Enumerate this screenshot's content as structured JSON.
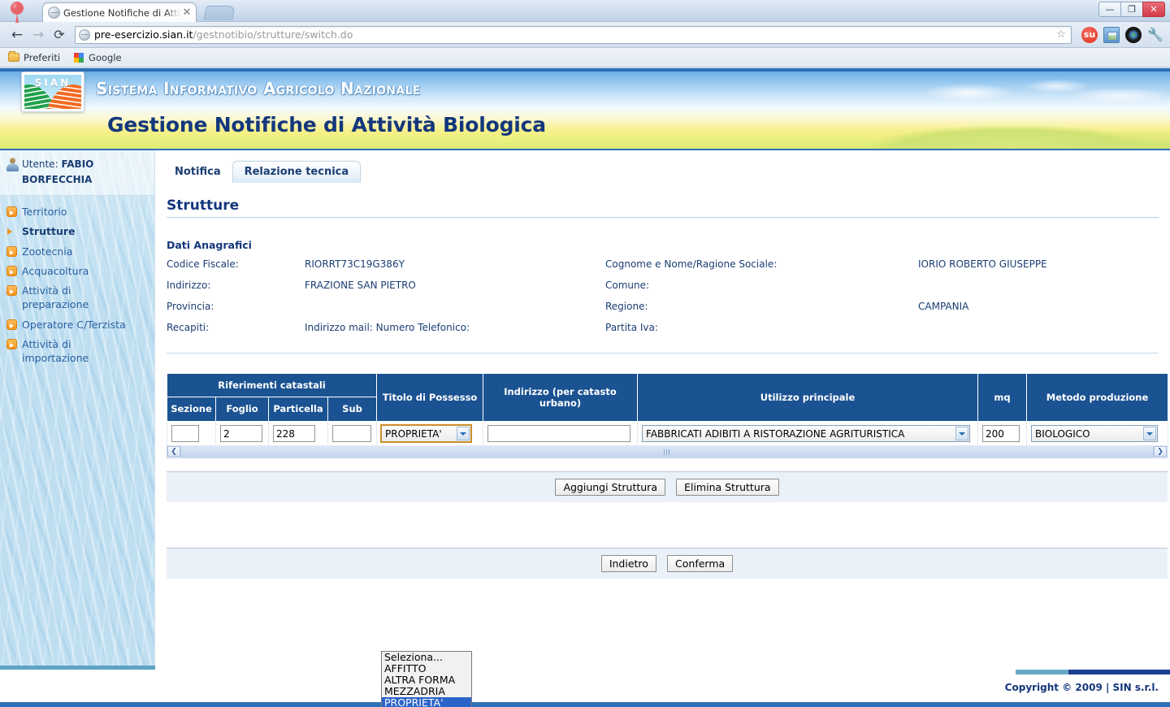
{
  "browser": {
    "tab_title": "Gestione Notifiche di Attività E",
    "tab_close": "✕",
    "back_icon": "←",
    "forward_icon": "→",
    "reload_icon": "⟳",
    "url_host": "pre-esercizio.sian.it",
    "url_path": "/gestnotibio/strutture/switch.do",
    "star_icon": "☆",
    "stumbleupon_label": "su",
    "wrench_icon": "🔧",
    "window_minimize": "—",
    "window_restore": "❐",
    "window_close": "✕",
    "bookmarks": [
      {
        "label": "Preferiti",
        "icon": "folder-icon"
      },
      {
        "label": "Google",
        "icon": "google-icon"
      }
    ]
  },
  "site": {
    "logo_text": "SIAN",
    "banner_title": "Sistema Informativo Agricolo Nazionale",
    "app_title": "Gestione Notifiche di Attività Biologica"
  },
  "sidebar": {
    "user_prefix": "Utente:",
    "user_name": "FABIO BORFECCHIA",
    "items": [
      {
        "label": "Territorio",
        "active": false
      },
      {
        "label": "Strutture",
        "active": true
      },
      {
        "label": "Zootecnia",
        "active": false
      },
      {
        "label": "Acquacoltura",
        "active": false
      },
      {
        "label": "Attività di preparazione",
        "active": false
      },
      {
        "label": "Operatore C/Terzista",
        "active": false
      },
      {
        "label": "Attività di importazione",
        "active": false
      }
    ]
  },
  "content": {
    "tab_notifica": "Notifica",
    "tab_relazione": "Relazione tecnica",
    "section_title": "Strutture",
    "anagrafici": {
      "heading": "Dati Anagrafici",
      "rows": [
        {
          "l1": "Codice Fiscale:",
          "v1": "RIORRT73C19G386Y",
          "l2": "Cognome e Nome/Ragione Sociale:",
          "v2": "IORIO ROBERTO GIUSEPPE"
        },
        {
          "l1": "Indirizzo:",
          "v1": "FRAZIONE SAN PIETRO",
          "l2": "Comune:",
          "v2": ""
        },
        {
          "l1": "Provincia:",
          "v1": "",
          "l2": "Regione:",
          "v2": "CAMPANIA"
        },
        {
          "l1": "Recapiti:",
          "v1": "Indirizzo mail: Numero Telefonico:",
          "l2": "Partita Iva:",
          "v2": ""
        }
      ]
    },
    "table": {
      "group_headers": [
        "Riferimenti catastali",
        "Titolo di Possesso",
        "Indirizzo (per catasto urbano)",
        "Utilizzo principale",
        "mq",
        "Metodo produzione"
      ],
      "sub_headers": [
        "Sezione",
        "Foglio",
        "Particella",
        "Sub"
      ],
      "row": {
        "sezione": "",
        "foglio": "2",
        "particella": "228",
        "sub": "",
        "titolo_possesso": "PROPRIETA'",
        "indirizzo": "",
        "utilizzo": "FABBRICATI ADIBITI A RISTORAZIONE AGRITURISTICA",
        "mq": "200",
        "metodo": "BIOLOGICO"
      }
    },
    "dropdown": {
      "open": true,
      "options": [
        "Seleziona...",
        "AFFITTO",
        "ALTRA FORMA",
        "MEZZADRIA",
        "PROPRIETA'"
      ],
      "selected": "PROPRIETA'"
    },
    "buttons_row1": [
      "Aggiungi Struttura",
      "Elimina Struttura"
    ],
    "buttons_row2": [
      "Indietro",
      "Conferma"
    ],
    "scroll_left_icon": "❮",
    "scroll_right_icon": "❯"
  },
  "footer": {
    "copyright": "Copyright © 2009 | SIN s.r.l."
  },
  "colors": {
    "brand_blue": "#1a5292",
    "header_blue": "#14377c",
    "accent_orange": "#f0921b",
    "table_header": "#1a5292",
    "highlight": "#2a64c8"
  }
}
